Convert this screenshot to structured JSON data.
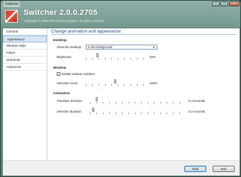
{
  "titlebar": {
    "title": "Switcher",
    "minimize_label": "–",
    "maximize_label": "□",
    "close_label": "x"
  },
  "banner": {
    "app_title": "Switcher 2.0.0.2705",
    "copyright": "Copyright © 2006-2007 by Bao Nguyen. All rights reserved."
  },
  "sidebar": {
    "items": [
      {
        "label": "General"
      },
      {
        "label": "Appearance"
      },
      {
        "label": "Window Style"
      },
      {
        "label": "Filters"
      },
      {
        "label": "Shortcuts"
      },
      {
        "label": "Advanced"
      }
    ],
    "active": "Appearance"
  },
  "main": {
    "header": "Change animation and appearance",
    "desktop": {
      "title": "Desktop",
      "show_label": "Show the desktop:",
      "show_value": "In the background",
      "brightness_label": "Brightness:",
      "brightness_value": "20%",
      "brightness": 0.2
    },
    "window": {
      "title": "Window",
      "enable_numbers_label": "Enable window numbers",
      "enable_numbers_checked": true,
      "check_glyph": "✓",
      "zoom_label": "Selection zoom:",
      "zoom_value": "100%",
      "zoom": 0.5
    },
    "animation": {
      "title": "Animation",
      "transition_label": "Transition duration:",
      "transition_value": "0.4 seconds",
      "transition": 0.07,
      "selection_label": "Selection duration:",
      "selection_value": "0.2 seconds",
      "selection": 0.03
    }
  },
  "footer": {
    "hide_label": "Hide",
    "exit_label": "Exit"
  }
}
